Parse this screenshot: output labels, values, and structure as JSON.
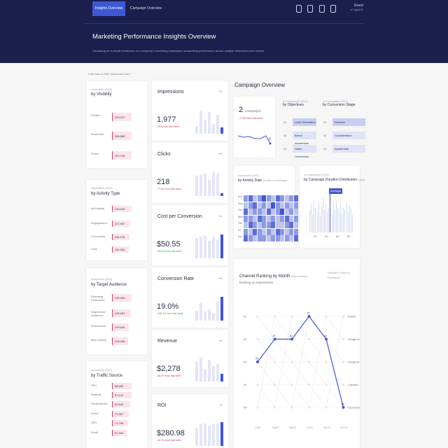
{
  "nav": {
    "active_tab": "Insights Overview",
    "tab": "Campaign Overview",
    "user_name": "Guest",
    "user_status": "● Logged In"
  },
  "header": {
    "title": "Marketing Performance Insights Overview",
    "subtitle": "Visualizing an in-depth breakdown of a company's marketing campaigns, showcasing performance across multiple dimensions and metrics"
  },
  "hint": "Click bars to filter dashboard view ↓",
  "breakdowns": [
    {
      "caption": "Impressions (2023)",
      "title": "by Visibility",
      "rows": [
        {
          "label": "Private",
          "value": "159,917"
        },
        {
          "label": "Restricted",
          "value": "158,688"
        },
        {
          "label": "Public",
          "value": "157,716"
        }
      ]
    },
    {
      "caption": "Impressions (2023)",
      "title": "by Activity Type",
      "rows": [
        {
          "label": "Ad Display",
          "value": "130,018"
        },
        {
          "label": "Engagement",
          "value": "117,947"
        },
        {
          "label": "Conversion",
          "value": "116,478"
        },
        {
          "label": "Click",
          "value": "112,081"
        }
      ]
    },
    {
      "caption": "Impressions (2023)",
      "title": "by Target Audience",
      "rows": [
        {
          "label": "Returning Customers",
          "value": "130,504"
        },
        {
          "label": "Segmented Audience",
          "value": "126,987"
        },
        {
          "label": "Subscribers",
          "value": "109,644"
        },
        {
          "label": "New Visitors",
          "value": "106,186"
        }
      ]
    },
    {
      "caption": "Impressions (2023)",
      "title": "by Traffic Source",
      "rows": [
        {
          "label": "PPC",
          "value": "88,663"
        },
        {
          "label": "Referral",
          "value": "87,141"
        },
        {
          "label": "Social Media",
          "value": "83,642"
        },
        {
          "label": "Direct",
          "value": "77,507"
        },
        {
          "label": "SEO",
          "value": "71,708"
        },
        {
          "label": "Email",
          "value": "67,342"
        }
      ]
    }
  ],
  "kpis": [
    {
      "title": "Impressions",
      "value": "1,977",
      "change": "-78% from last week",
      "trend": "neg",
      "bars": [
        0.3,
        0.9,
        0.55,
        0.85,
        0.4,
        0.75,
        0.25
      ]
    },
    {
      "title": "Clicks",
      "value": "218",
      "change": "-77.6% from last week",
      "trend": "neg",
      "bars": [
        0.75,
        0.8,
        0.85,
        0.6,
        0.9,
        0.85,
        0.1
      ]
    },
    {
      "title": "Cost per Conversion",
      "value": "$50.55",
      "change": "+38.6% from last week",
      "trend": "pos",
      "bars": [
        0.8,
        0.85,
        0.9,
        0.7,
        0.85,
        0.75,
        0.95
      ]
    },
    {
      "title": "Conversion Rate",
      "value": "19.0%",
      "change": "+331.1% from last week",
      "trend": "pos",
      "bars": [
        0.4,
        0.7,
        0.35,
        0.45,
        0.3,
        0.75,
        0.95
      ]
    },
    {
      "title": "Revenue",
      "value": "$2,278",
      "change": "-66.2% from last week",
      "trend": "neg",
      "bars": [
        0.8,
        0.95,
        0.5,
        0.85,
        0.6,
        0.7,
        0.3
      ]
    },
    {
      "title": "ROI",
      "value": "$280.98",
      "change": "-60.5% from last week",
      "trend": "neg",
      "bars": [
        0.7,
        0.85,
        0.9,
        0.8,
        0.85,
        0.9,
        0.95
      ]
    }
  ],
  "campaign": {
    "title": "Campaign Overview",
    "count": "2",
    "count_label": "Campaigns",
    "count_change": "-77.8% from last week",
    "spark_end": "2",
    "objectives": {
      "caption": "# of Campaigns (2023)",
      "title": "by Objectives",
      "rows": [
        {
          "label": "Lead Generation",
          "value": "1"
        },
        {
          "label": "Brand Awareness",
          "value": "0"
        },
        {
          "label": "Sales Conversion",
          "value": "0"
        }
      ]
    },
    "stages": {
      "caption": "# of Campaigns (2023)",
      "title": "by Conversion Stage",
      "rows": [
        {
          "label": "Decision",
          "value": "1"
        },
        {
          "label": "Consideration",
          "value": "0"
        },
        {
          "label": "Awareness",
          "value": "0"
        }
      ]
    }
  },
  "activity": {
    "caption": "Impressions (2023)",
    "title": "by Activity Date",
    "note": "(months vs weekdays)",
    "days": [
      "Sun",
      "Mon",
      "Tue",
      "Wed",
      "Thu",
      "Fri",
      "Sat"
    ],
    "grid": [
      [
        2,
        3,
        1,
        2,
        4,
        2,
        1,
        3,
        2,
        1,
        2,
        3
      ],
      [
        1,
        2,
        3,
        1,
        2,
        1,
        4,
        2,
        1,
        2,
        1,
        2
      ],
      [
        3,
        1,
        2,
        2,
        1,
        3,
        1,
        2,
        4,
        1,
        2,
        1
      ],
      [
        2,
        2,
        1,
        3,
        2,
        1,
        2,
        1,
        2,
        3,
        1,
        2
      ],
      [
        1,
        3,
        2,
        1,
        2,
        2,
        3,
        1,
        1,
        2,
        3,
        1
      ],
      [
        2,
        1,
        3,
        2,
        1,
        2,
        1,
        3,
        2,
        1,
        2,
        2
      ],
      [
        3,
        2,
        1,
        2,
        2,
        1,
        2,
        2,
        1,
        2,
        1,
        3
      ]
    ],
    "palette": [
      "#dfe3f7",
      "#bcc4ef",
      "#8d9ae4",
      "#5b6dd8",
      "#3f57d6"
    ]
  },
  "duration": {
    "caption": "# of Campaigns (2023)",
    "title": "by Campaign Duration Distribution",
    "note": "(days)",
    "x_ticks": [
      "20",
      "40",
      "60",
      "80"
    ],
    "tooltip": "Average",
    "bars": [
      0.55,
      0.7,
      0.45,
      0.8,
      0.6,
      0.5,
      0.75,
      0.4,
      0.65,
      0.85,
      0.55,
      0.7,
      0.5,
      0.6,
      0.95,
      0.45,
      0.75,
      0.55,
      0.8,
      0.6,
      0.5,
      0.7,
      0.45,
      0.6,
      0.55,
      0.7,
      0.5,
      0.65,
      0.6,
      0.45
    ],
    "highlight": 14
  },
  "ranking": {
    "title": "Channel Ranking by Month",
    "note": "(last 6 months)",
    "subtitle": "Ranking on Impressions",
    "selected_label": "Selected Channel",
    "selected_value": "Facebook",
    "ranks": [
      "#1",
      "#2",
      "#3",
      "#4",
      "#5"
    ],
    "months": [
      "Jul23",
      "Aug23",
      "Sep23",
      "Oct23",
      "Nov23",
      "Dec23"
    ],
    "channels": [
      "Twitter",
      "Google Ads",
      "Instagram",
      "LinkedIn",
      "Facebook"
    ],
    "selected_path": [
      3,
      2,
      2,
      1,
      2,
      5
    ],
    "point_labels": [
      "#3",
      "#2",
      "#2",
      "#1",
      "#2",
      "#5"
    ]
  }
}
